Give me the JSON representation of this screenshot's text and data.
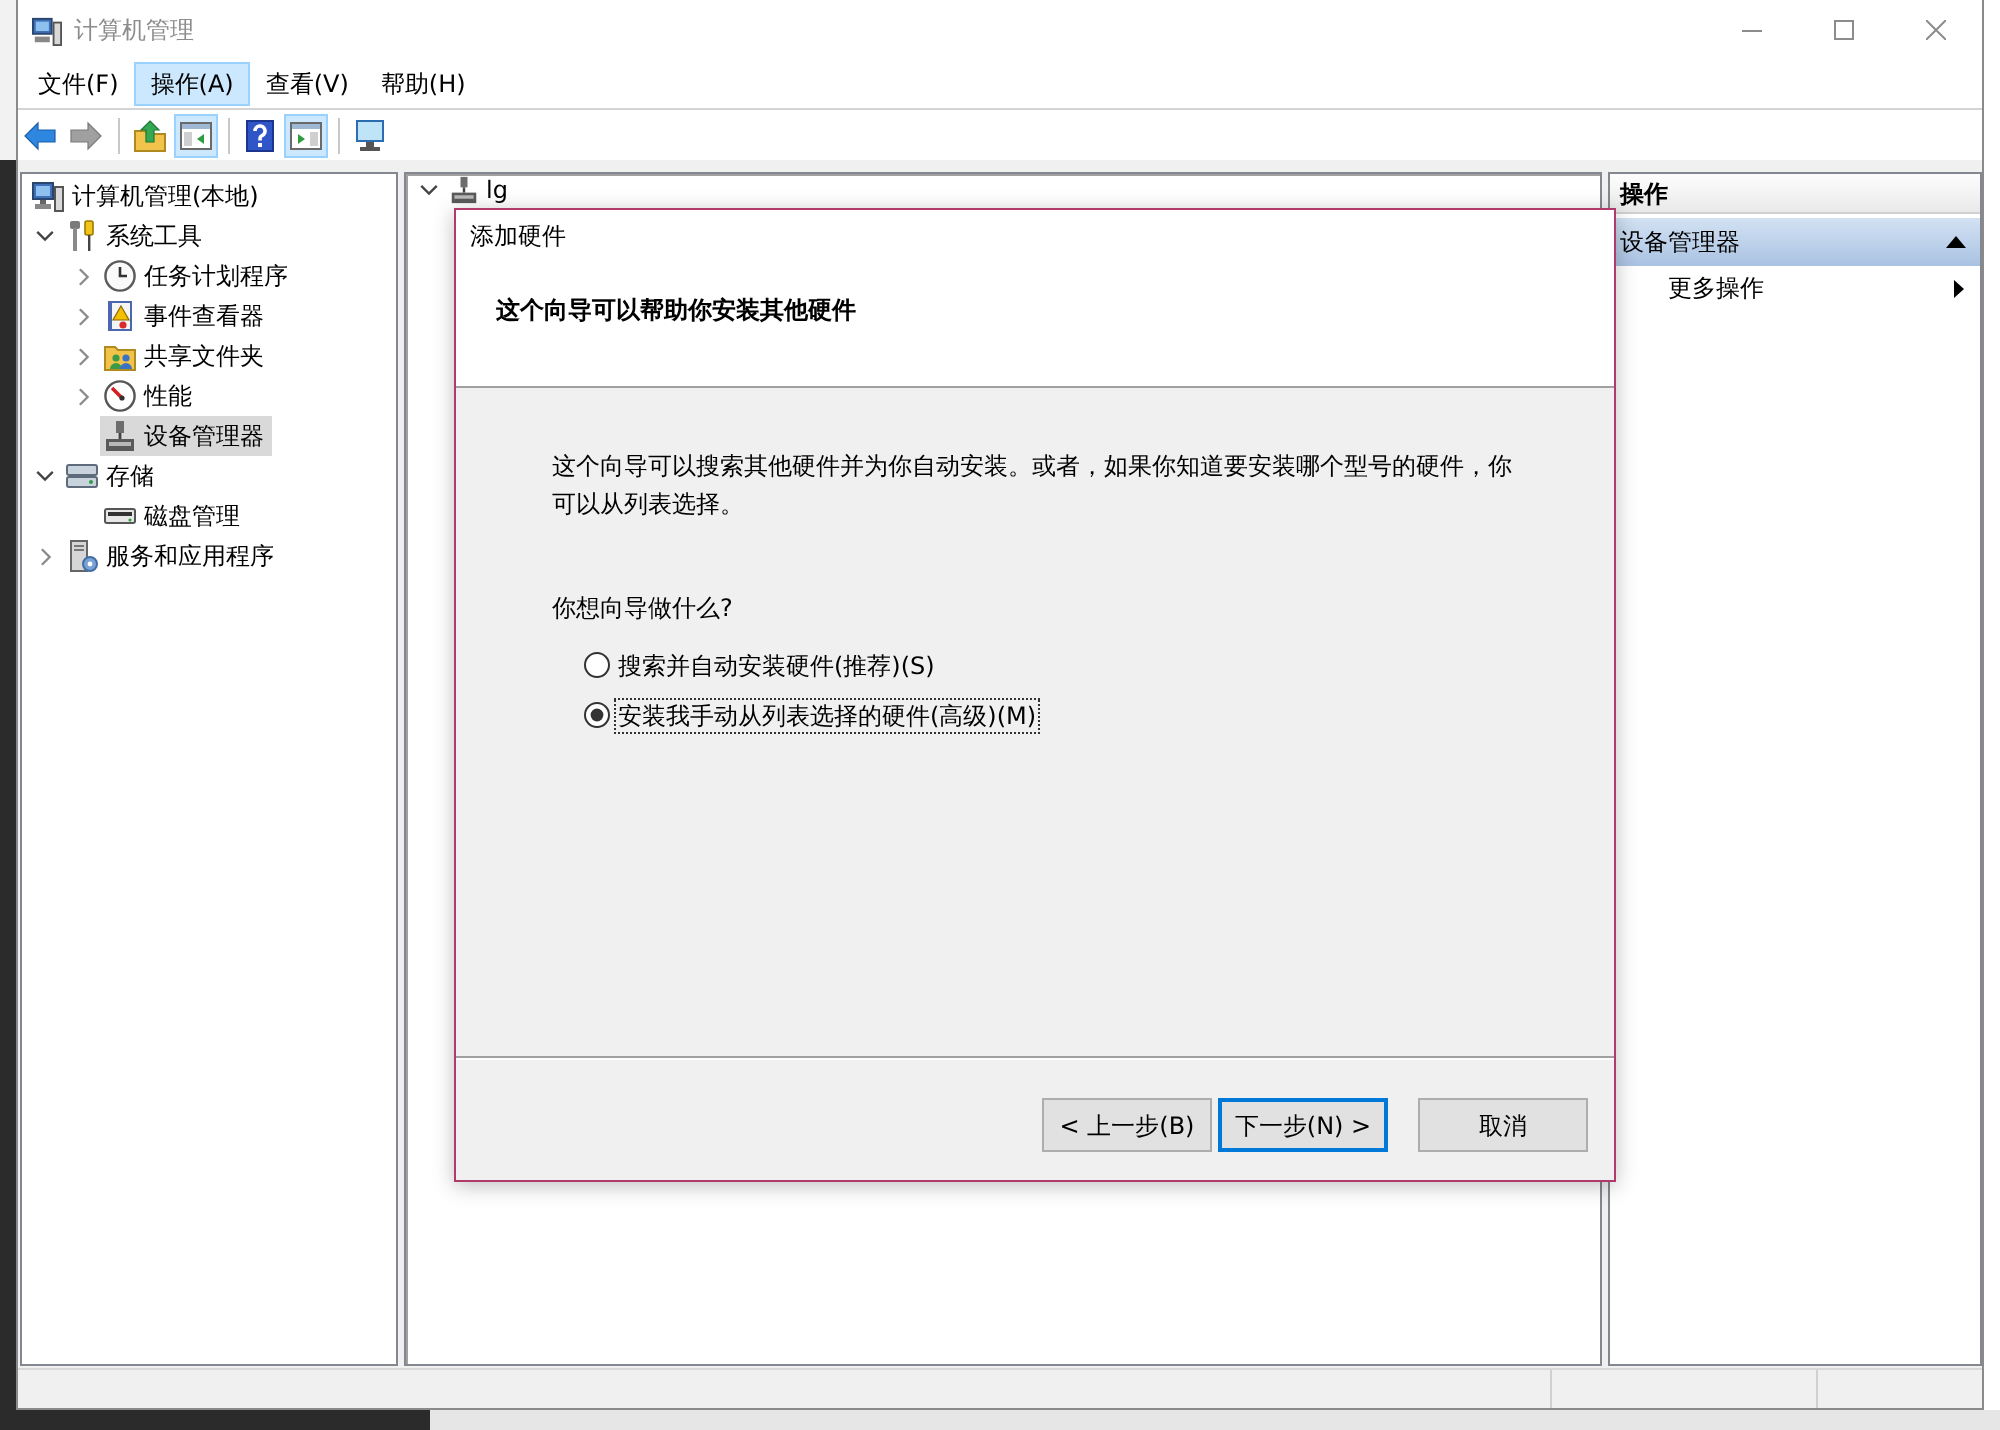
{
  "window": {
    "title": "计算机管理"
  },
  "menu": [
    {
      "label": "文件(F)",
      "selected": false
    },
    {
      "label": "操作(A)",
      "selected": true
    },
    {
      "label": "查看(V)",
      "selected": false
    },
    {
      "label": "帮助(H)",
      "selected": false
    }
  ],
  "toolbar": [
    [
      {
        "kind": "back",
        "on": false,
        "disabled": false
      },
      {
        "kind": "forward",
        "on": false,
        "disabled": true
      }
    ],
    [
      {
        "kind": "folder_up",
        "on": false
      },
      {
        "kind": "tree_pane",
        "on": true
      }
    ],
    [
      {
        "kind": "help",
        "on": false
      },
      {
        "kind": "action_pane",
        "on": true
      }
    ],
    [
      {
        "kind": "connect",
        "on": false
      }
    ]
  ],
  "tree": [
    {
      "label": "计算机管理(本地)",
      "kind": "computer",
      "selected": false,
      "children": [
        {
          "label": "系统工具",
          "kind": "tools",
          "expanded": true,
          "selected": false,
          "children": [
            {
              "label": "任务计划程序",
              "kind": "scheduler",
              "expanded": false,
              "selected": false
            },
            {
              "label": "事件查看器",
              "kind": "event_log",
              "expanded": false,
              "selected": false
            },
            {
              "label": "共享文件夹",
              "kind": "shared_folder",
              "expanded": false,
              "selected": false
            },
            {
              "label": "性能",
              "kind": "performance",
              "expanded": false,
              "selected": false
            },
            {
              "label": "设备管理器",
              "kind": "device",
              "selected": true
            }
          ]
        },
        {
          "label": "存储",
          "kind": "storage",
          "expanded": true,
          "selected": false,
          "children": [
            {
              "label": "磁盘管理",
              "kind": "disk",
              "selected": false
            }
          ]
        },
        {
          "label": "服务和应用程序",
          "kind": "services",
          "expanded": false,
          "selected": false
        }
      ]
    }
  ],
  "details": [
    {
      "label": "lg",
      "kind": "device",
      "expanded": true,
      "selected": false
    }
  ],
  "dialog": {
    "title": "添加硬件",
    "heading": "这个向导可以帮助你安装其他硬件",
    "description": "这个向导可以搜索其他硬件并为你自动安装。或者，如果你知道要安装哪个型号的硬件，你可以从列表选择。",
    "question": "你想向导做什么?",
    "options": [
      {
        "label": "搜索并自动安装硬件(推荐)(S)",
        "selected": false,
        "focused": false
      },
      {
        "label": "安装我手动从列表选择的硬件(高级)(M)",
        "selected": true,
        "focused": true
      }
    ],
    "buttons": [
      {
        "label": "< 上一步(B)",
        "default": false
      },
      {
        "label": "下一步(N) >",
        "default": true
      },
      {
        "label": "取消",
        "default": false
      }
    ]
  },
  "actions": {
    "title": "操作",
    "sections": [
      {
        "label": "设备管理器",
        "expanded": true,
        "items": [
          {
            "label": "更多操作",
            "submenu": true
          }
        ]
      }
    ]
  }
}
